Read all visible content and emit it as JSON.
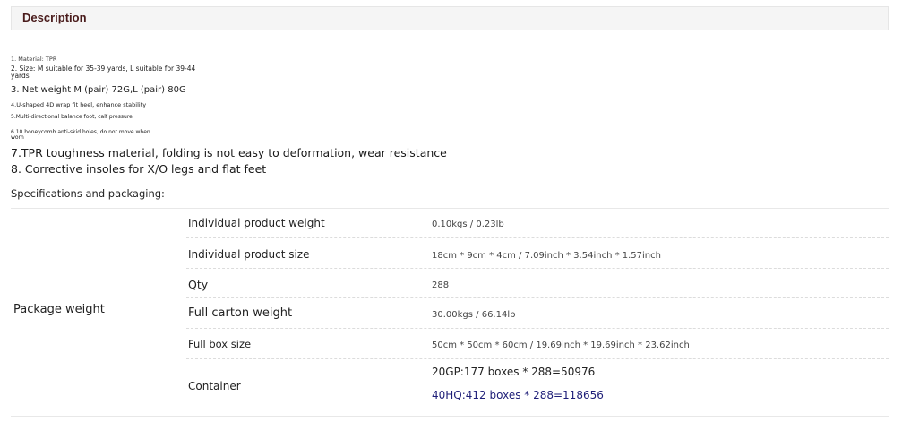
{
  "description": {
    "header": "Description",
    "lines": [
      "1. Material: TPR",
      "2. Size: M suitable for 35-39 yards, L suitable for 39-44 yards",
      "3. Net weight M (pair) 72G,L (pair) 80G",
      "4.U-shaped 4D wrap fit heel, enhance stability",
      "5.Multi-directional balance foot, calf pressure",
      "6.10 honeycomb anti-skid holes, do not move when worn",
      "7.TPR toughness material, folding is not easy to deformation, wear resistance",
      "8. Corrective insoles for X/O legs and flat feet"
    ]
  },
  "specs": {
    "title": "Specifications and packaging:",
    "group_label": "Package weight",
    "rows": [
      {
        "key": "Individual product weight",
        "value": "0.10kgs / 0.23lb"
      },
      {
        "key": "Individual product size",
        "value": "18cm * 9cm * 4cm / 7.09inch * 3.54inch * 1.57inch"
      },
      {
        "key": "Qty",
        "value": "288"
      },
      {
        "key": "Full carton weight",
        "value": "30.00kgs / 66.14lb"
      },
      {
        "key": "Full box size",
        "value": "50cm * 50cm * 60cm / 19.69inch * 19.69inch * 23.62inch"
      },
      {
        "key": "Container",
        "values": [
          "20GP:177 boxes * 288=50976",
          "40HQ:412 boxes * 288=118656"
        ]
      }
    ]
  },
  "colors": {
    "header_text": "#4a1c1c",
    "container_highlight": "#1e1e78"
  }
}
